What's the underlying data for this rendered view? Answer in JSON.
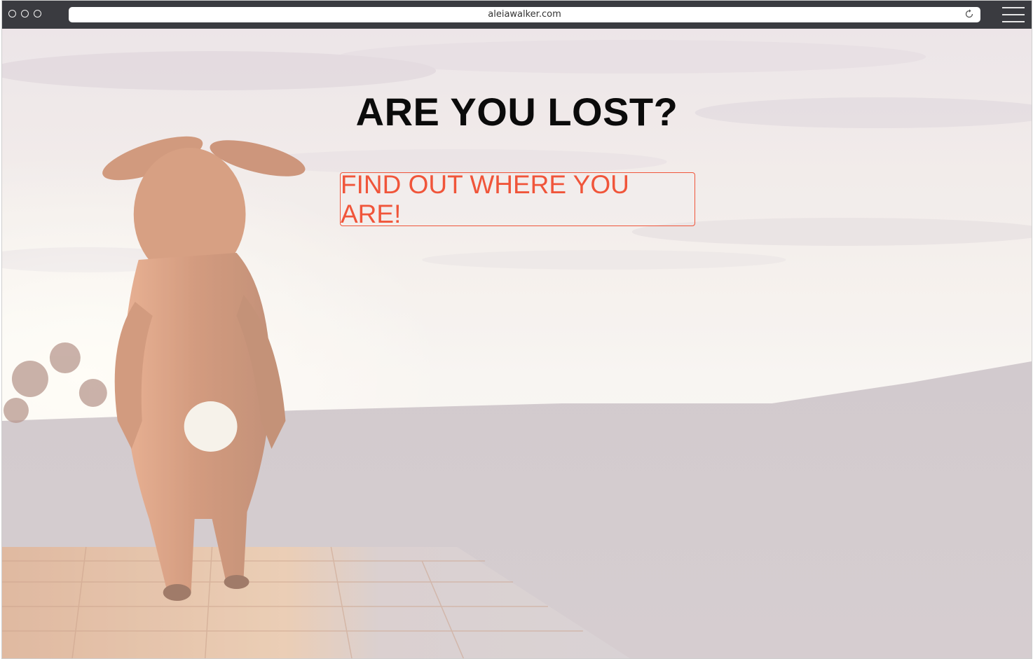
{
  "browser": {
    "url": "aleiawalker.com"
  },
  "hero": {
    "heading": "ARE YOU LOST?",
    "cta_label": "FIND OUT WHERE YOU ARE!"
  },
  "colors": {
    "accent": "#f0553a",
    "heading": "#0b0b0b",
    "chrome": "#3a3b40"
  }
}
